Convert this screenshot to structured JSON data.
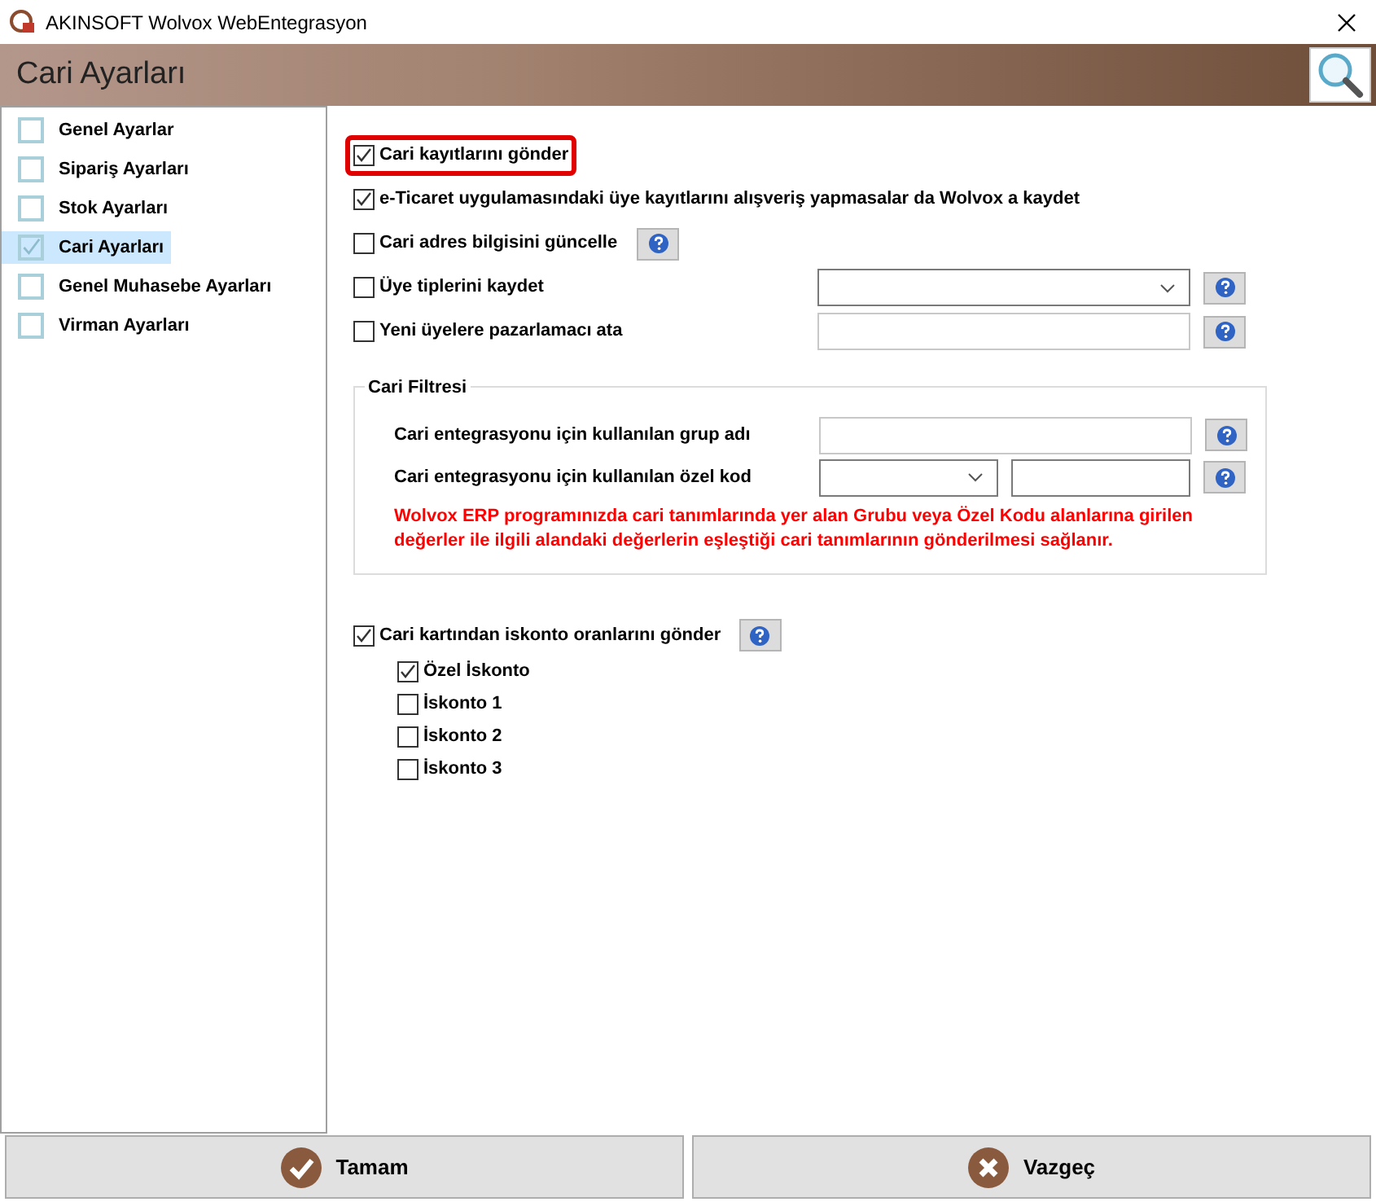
{
  "window": {
    "title": "AKINSOFT Wolvox WebEntegrasyon"
  },
  "header": {
    "title": "Cari Ayarları"
  },
  "sidebar": {
    "items": [
      {
        "label": "Genel Ayarlar",
        "checked": false,
        "selected": false
      },
      {
        "label": "Sipariş Ayarları",
        "checked": false,
        "selected": false
      },
      {
        "label": "Stok Ayarları",
        "checked": false,
        "selected": false
      },
      {
        "label": "Cari Ayarları",
        "checked": true,
        "selected": true
      },
      {
        "label": "Genel Muhasebe Ayarları",
        "checked": false,
        "selected": false
      },
      {
        "label": "Virman Ayarları",
        "checked": false,
        "selected": false
      }
    ]
  },
  "options": [
    {
      "label": "Cari kayıtlarını gönder",
      "checked": true,
      "highlighted": true,
      "kind": "plain"
    },
    {
      "label": "e-Ticaret uygulamasındaki üye kayıtlarını alışveriş yapmasalar da Wolvox a kaydet",
      "checked": true,
      "highlighted": false,
      "kind": "plain"
    },
    {
      "label": "Cari adres bilgisini güncelle",
      "checked": false,
      "highlighted": false,
      "kind": "help"
    },
    {
      "label": "Üye tiplerini kaydet",
      "checked": false,
      "highlighted": false,
      "kind": "select"
    },
    {
      "label": "Yeni üyelere pazarlamacı ata",
      "checked": false,
      "highlighted": false,
      "kind": "input"
    }
  ],
  "filter": {
    "title": "Cari Filtresi",
    "rows": [
      {
        "label": "Cari entegrasyonu için kullanılan grup adı",
        "kind": "input"
      },
      {
        "label": "Cari entegrasyonu için kullanılan özel kod",
        "kind": "select_input"
      }
    ],
    "note": "Wolvox ERP programınızda cari tanımlarında yer alan Grubu veya Özel Kodu alanlarına girilen değerler ile ilgili alandaki değerlerin eşleştiği cari tanımlarının gönderilmesi sağlanır."
  },
  "discount": {
    "label": "Cari kartından iskonto oranlarını gönder",
    "checked": true,
    "items": [
      {
        "label": "Özel İskonto",
        "checked": true
      },
      {
        "label": "İskonto 1",
        "checked": false
      },
      {
        "label": "İskonto 2",
        "checked": false
      },
      {
        "label": "İskonto 3",
        "checked": false
      }
    ]
  },
  "buttons": [
    {
      "label": "Tamam",
      "kind": "ok"
    },
    {
      "label": "Vazgeç",
      "kind": "cancel"
    }
  ]
}
